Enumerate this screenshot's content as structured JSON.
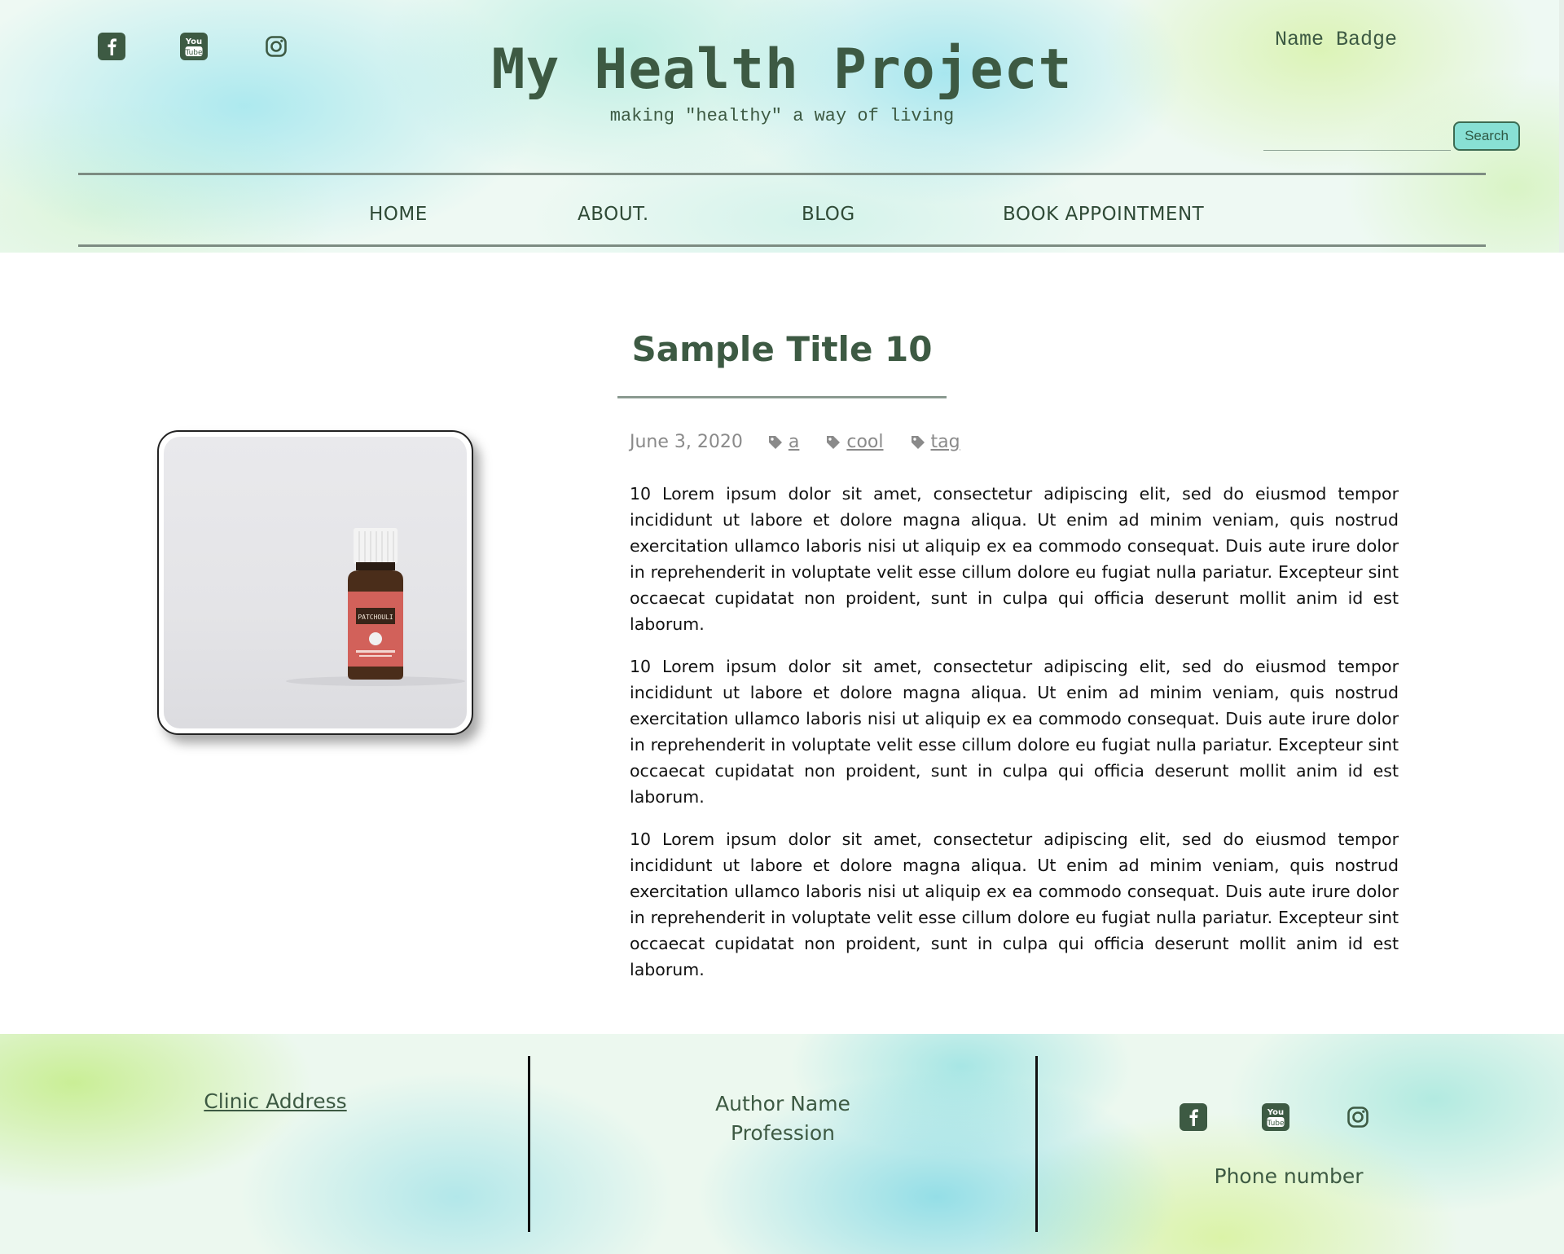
{
  "header": {
    "site_title": "My Health Project",
    "tagline": "making \"healthy\" a way of living",
    "name_badge": "Name Badge",
    "search": {
      "placeholder": "",
      "button_label": "Search"
    },
    "social_icons": [
      "facebook-icon",
      "youtube-icon",
      "instagram-icon"
    ]
  },
  "nav": {
    "items": [
      {
        "label": "HOME"
      },
      {
        "label": "ABOUT."
      },
      {
        "label": "BLOG"
      },
      {
        "label": "BOOK APPOINTMENT"
      }
    ]
  },
  "post": {
    "title": "Sample Title 10",
    "date": "June 3, 2020",
    "tags": [
      "a",
      "cool",
      "tag"
    ],
    "image": {
      "bottle_label": "PATCHOULI"
    },
    "paragraphs": [
      "10 Lorem ipsum dolor sit amet, consectetur adipiscing elit, sed do eiusmod tempor incididunt ut labore et dolore magna aliqua. Ut enim ad minim veniam, quis nostrud exercitation ullamco laboris nisi ut aliquip ex ea commodo consequat. Duis aute irure dolor in reprehenderit in voluptate velit esse cillum dolore eu fugiat nulla pariatur. Excepteur sint occaecat cupidatat non proident, sunt in culpa qui officia deserunt mollit anim id est laborum.",
      "10 Lorem ipsum dolor sit amet, consectetur adipiscing elit, sed do eiusmod tempor incididunt ut labore et dolore magna aliqua. Ut enim ad minim veniam, quis nostrud exercitation ullamco laboris nisi ut aliquip ex ea commodo consequat. Duis aute irure dolor in reprehenderit in voluptate velit esse cillum dolore eu fugiat nulla pariatur. Excepteur sint occaecat cupidatat non proident, sunt in culpa qui officia deserunt mollit anim id est laborum.",
      "10 Lorem ipsum dolor sit amet, consectetur adipiscing elit, sed do eiusmod tempor incididunt ut labore et dolore magna aliqua. Ut enim ad minim veniam, quis nostrud exercitation ullamco laboris nisi ut aliquip ex ea commodo consequat. Duis aute irure dolor in reprehenderit in voluptate velit esse cillum dolore eu fugiat nulla pariatur. Excepteur sint occaecat cupidatat non proident, sunt in culpa qui officia deserunt mollit anim id est laborum."
    ]
  },
  "footer": {
    "address_link": "Clinic Address",
    "author_name": "Author Name",
    "profession": "Profession",
    "phone": "Phone number",
    "social_icons": [
      "facebook-icon",
      "youtube-icon",
      "instagram-icon"
    ]
  },
  "colors": {
    "brand_green": "#3d5a43",
    "search_button": "#88e0d4",
    "meta_gray": "#8a8a8a"
  }
}
